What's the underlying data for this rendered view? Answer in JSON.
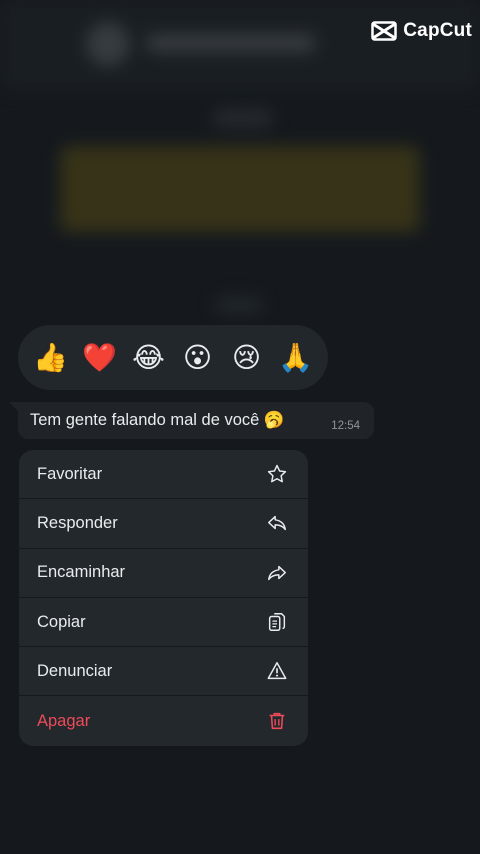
{
  "watermark": {
    "text": "CapCut"
  },
  "reactions": [
    {
      "emoji": "👍",
      "icon": "thumbs-up"
    },
    {
      "emoji": "❤️",
      "icon": "red-heart"
    },
    {
      "emoji": "😂",
      "icon": "tears-of-joy"
    },
    {
      "emoji": "😮",
      "icon": "open-mouth"
    },
    {
      "emoji": "😢",
      "icon": "crying-face"
    },
    {
      "emoji": "🙏",
      "icon": "folded-hands"
    }
  ],
  "message": {
    "text": "Tem gente falando mal de você 🥱",
    "time": "12:54"
  },
  "menu": {
    "items": [
      {
        "label": "Favoritar",
        "icon": "star-icon"
      },
      {
        "label": "Responder",
        "icon": "reply-icon"
      },
      {
        "label": "Encaminhar",
        "icon": "forward-icon"
      },
      {
        "label": "Copiar",
        "icon": "copy-icon"
      },
      {
        "label": "Denunciar",
        "icon": "warning-icon"
      },
      {
        "label": "Apagar",
        "icon": "trash-icon",
        "color": "#ee4b5a"
      }
    ]
  }
}
